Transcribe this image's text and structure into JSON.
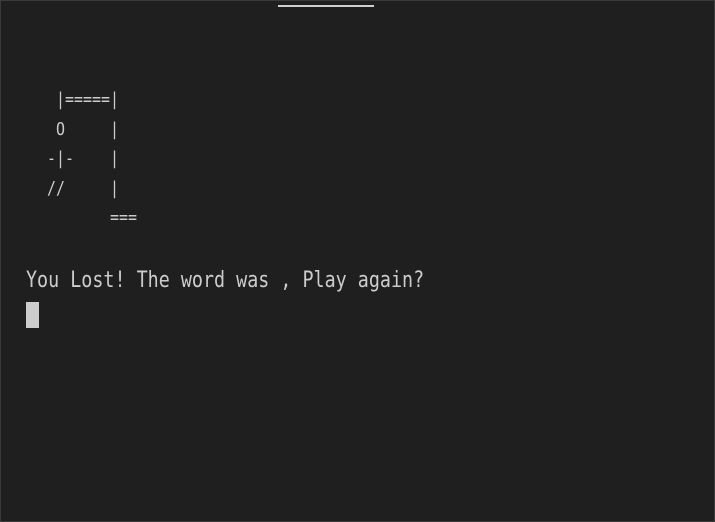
{
  "terminal": {
    "hangman_art": "   |=====|\n   O     |\n  -|-    |\n  //     |\n         ===",
    "message": "You Lost! The word was , Play again?"
  },
  "colors": {
    "background": "#1f1f1f",
    "text": "#cccccc",
    "cursor": "#cccccc"
  }
}
